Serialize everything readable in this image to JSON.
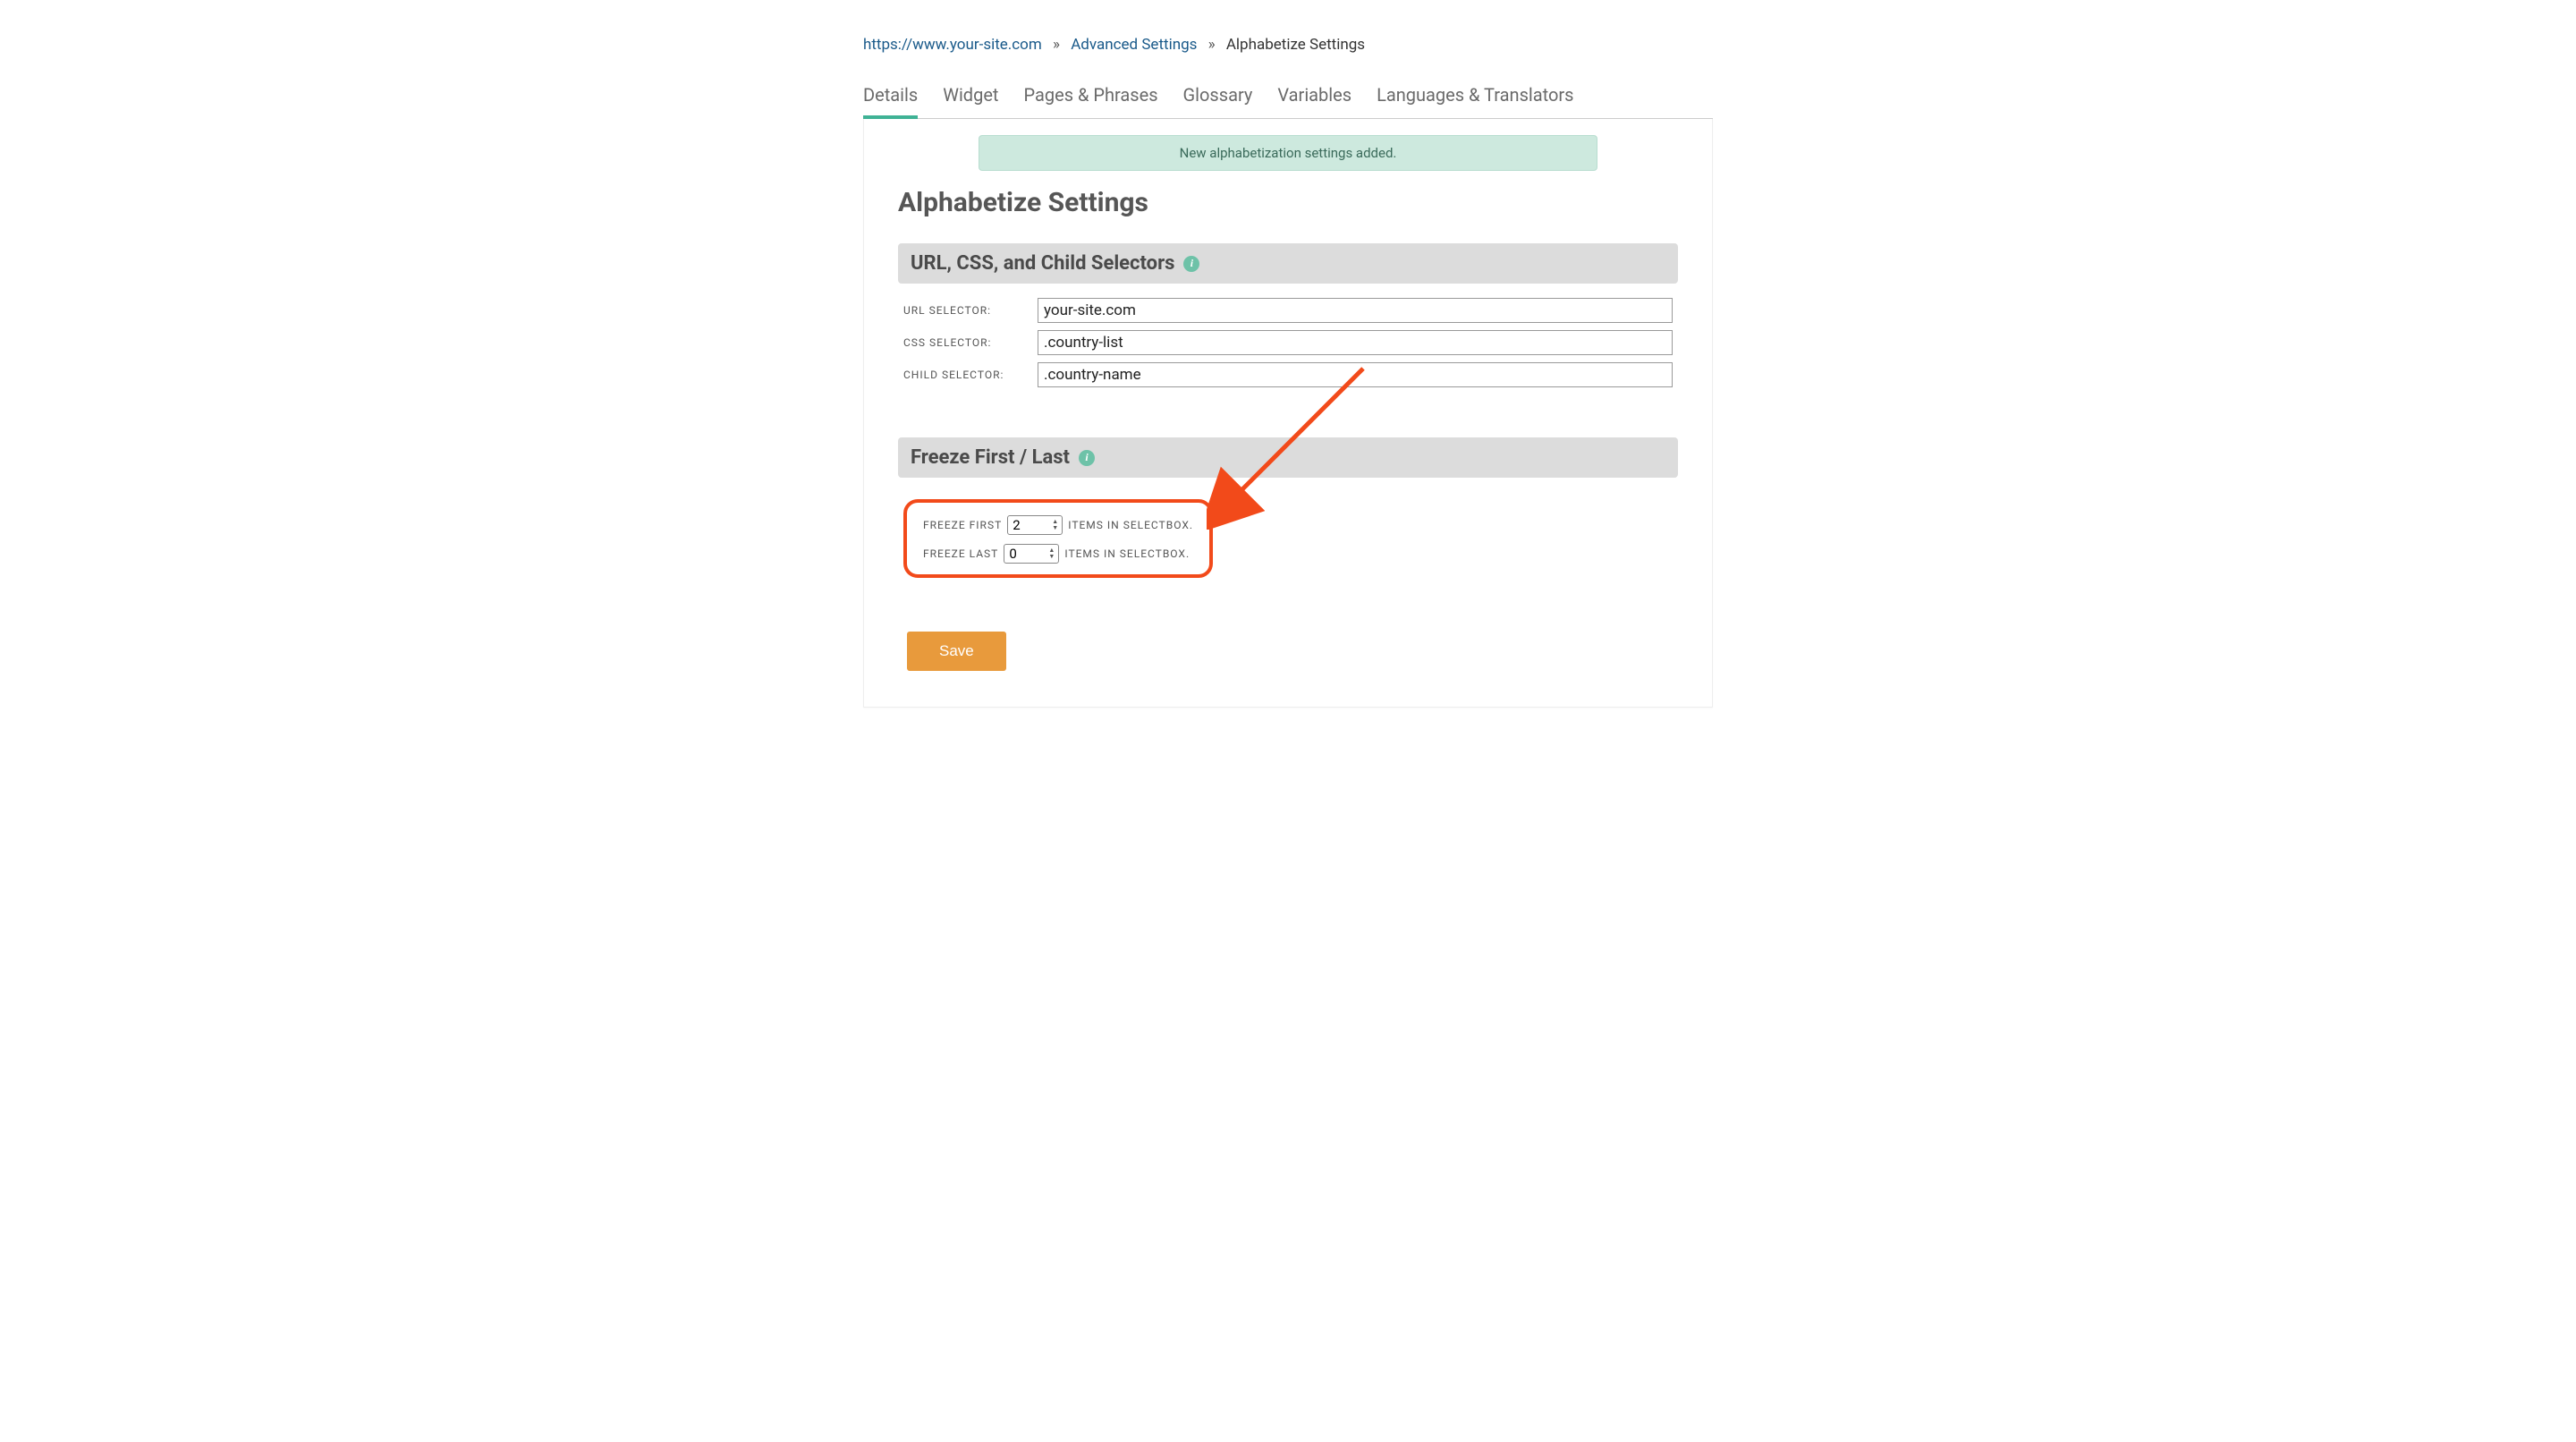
{
  "breadcrumb": {
    "site_url": "https://www.your-site.com",
    "advanced": "Advanced Settings",
    "current": "Alphabetize Settings"
  },
  "tabs": [
    {
      "label": "Details",
      "active": true
    },
    {
      "label": "Widget",
      "active": false
    },
    {
      "label": "Pages & Phrases",
      "active": false
    },
    {
      "label": "Glossary",
      "active": false
    },
    {
      "label": "Variables",
      "active": false
    },
    {
      "label": "Languages & Translators",
      "active": false
    }
  ],
  "alert": "New alphabetization settings added.",
  "page_title": "Alphabetize Settings",
  "sections": {
    "selectors": {
      "heading": "URL, CSS, and Child Selectors",
      "url_label": "URL SELECTOR:",
      "url_value": "your-site.com",
      "css_label": "CSS SELECTOR:",
      "css_value": ".country-list",
      "child_label": "CHILD SELECTOR:",
      "child_value": ".country-name"
    },
    "freeze": {
      "heading": "Freeze First / Last",
      "first_prefix": "FREEZE FIRST",
      "first_value": "2",
      "first_suffix": "ITEMS IN SELECTBOX.",
      "last_prefix": "FREEZE LAST",
      "last_value": "0",
      "last_suffix": "ITEMS IN SELECTBOX."
    }
  },
  "save_label": "Save"
}
